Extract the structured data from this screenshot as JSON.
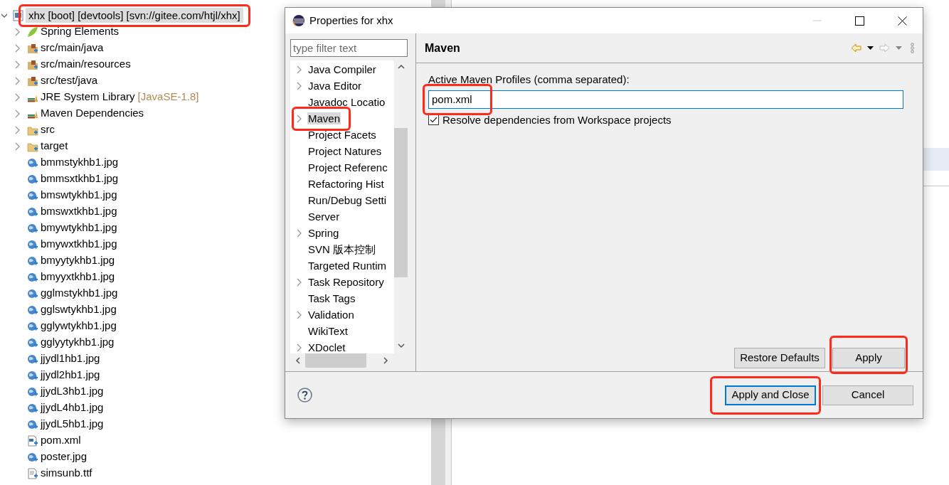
{
  "project_tree": {
    "root": {
      "label": "xhx [boot] [devtools] [svn://gitee.com/htjl/xhx]",
      "expanded": true,
      "highlighted": true
    },
    "children": [
      {
        "label": "Spring Elements",
        "kind": "spring",
        "expandable": true
      },
      {
        "label": "src/main/java",
        "kind": "package",
        "expandable": true
      },
      {
        "label": "src/main/resources",
        "kind": "package",
        "expandable": true
      },
      {
        "label": "src/test/java",
        "kind": "package",
        "expandable": true
      },
      {
        "label": "JRE System Library",
        "decoration": "[JavaSE-1.8]",
        "kind": "library",
        "expandable": true
      },
      {
        "label": "Maven Dependencies",
        "kind": "library",
        "expandable": true
      },
      {
        "label": "src",
        "kind": "folder",
        "expandable": true
      },
      {
        "label": "target",
        "kind": "folder",
        "expandable": true
      },
      {
        "label": "bmmstykhb1.jpg",
        "kind": "image",
        "expandable": false
      },
      {
        "label": "bmmsxtkhb1.jpg",
        "kind": "image",
        "expandable": false
      },
      {
        "label": "bmswtykhb1.jpg",
        "kind": "image",
        "expandable": false
      },
      {
        "label": "bmswxtkhb1.jpg",
        "kind": "image",
        "expandable": false
      },
      {
        "label": "bmywtykhb1.jpg",
        "kind": "image",
        "expandable": false
      },
      {
        "label": "bmywxtkhb1.jpg",
        "kind": "image",
        "expandable": false
      },
      {
        "label": "bmyytykhb1.jpg",
        "kind": "image",
        "expandable": false
      },
      {
        "label": "bmyyxtkhb1.jpg",
        "kind": "image",
        "expandable": false
      },
      {
        "label": "gglmstykhb1.jpg",
        "kind": "image",
        "expandable": false
      },
      {
        "label": "gglswtykhb1.jpg",
        "kind": "image",
        "expandable": false
      },
      {
        "label": "gglywtykhb1.jpg",
        "kind": "image",
        "expandable": false
      },
      {
        "label": "gglyytykhb1.jpg",
        "kind": "image",
        "expandable": false
      },
      {
        "label": "jjydl1hb1.jpg",
        "kind": "image",
        "expandable": false
      },
      {
        "label": "jjydl2hb1.jpg",
        "kind": "image",
        "expandable": false
      },
      {
        "label": "jjydL3hb1.jpg",
        "kind": "image",
        "expandable": false
      },
      {
        "label": "jjydL4hb1.jpg",
        "kind": "image",
        "expandable": false
      },
      {
        "label": "jjydL5hb1.jpg",
        "kind": "image",
        "expandable": false
      },
      {
        "label": "pom.xml",
        "kind": "xml",
        "expandable": false
      },
      {
        "label": "poster.jpg",
        "kind": "image",
        "expandable": false
      },
      {
        "label": "simsunb.ttf",
        "kind": "file",
        "expandable": false
      }
    ]
  },
  "dialog": {
    "title": "Properties for xhx",
    "filter": {
      "placeholder": "type filter text"
    },
    "nav_items": [
      {
        "label": "Java Compiler",
        "expandable": true,
        "selected": false,
        "highlighted": false
      },
      {
        "label": "Java Editor",
        "expandable": true,
        "selected": false,
        "highlighted": false
      },
      {
        "label": "Javadoc Locatio",
        "expandable": false,
        "selected": false,
        "highlighted": false
      },
      {
        "label": "Maven",
        "expandable": true,
        "selected": true,
        "highlighted": true
      },
      {
        "label": "Project Facets",
        "expandable": false,
        "selected": false,
        "highlighted": false
      },
      {
        "label": "Project Natures",
        "expandable": false,
        "selected": false,
        "highlighted": false
      },
      {
        "label": "Project Referenc",
        "expandable": false,
        "selected": false,
        "highlighted": false
      },
      {
        "label": "Refactoring Hist",
        "expandable": false,
        "selected": false,
        "highlighted": false
      },
      {
        "label": "Run/Debug Setti",
        "expandable": false,
        "selected": false,
        "highlighted": false
      },
      {
        "label": "Server",
        "expandable": false,
        "selected": false,
        "highlighted": false
      },
      {
        "label": "Spring",
        "expandable": true,
        "selected": false,
        "highlighted": false
      },
      {
        "label": "SVN 版本控制",
        "expandable": false,
        "selected": false,
        "highlighted": false
      },
      {
        "label": "Targeted Runtim",
        "expandable": false,
        "selected": false,
        "highlighted": false
      },
      {
        "label": "Task Repository",
        "expandable": true,
        "selected": false,
        "highlighted": false
      },
      {
        "label": "Task Tags",
        "expandable": false,
        "selected": false,
        "highlighted": false
      },
      {
        "label": "Validation",
        "expandable": true,
        "selected": false,
        "highlighted": false
      },
      {
        "label": "WikiText",
        "expandable": false,
        "selected": false,
        "highlighted": false
      },
      {
        "label": "XDoclet",
        "expandable": true,
        "selected": false,
        "highlighted": false
      }
    ],
    "page_title": "Maven",
    "profiles": {
      "label": "Active Maven Profiles (comma separated):",
      "value": "pom.xml",
      "highlighted": true
    },
    "resolve_workspace": {
      "label": "Resolve dependencies from Workspace projects",
      "checked": true
    },
    "page_buttons": [
      {
        "label": "Restore Defaults",
        "highlighted": false
      },
      {
        "label": "Apply",
        "highlighted": true
      }
    ],
    "footer_buttons": [
      {
        "label": "Apply and Close",
        "default": true,
        "highlighted": true
      },
      {
        "label": "Cancel",
        "default": false,
        "highlighted": false
      }
    ]
  }
}
